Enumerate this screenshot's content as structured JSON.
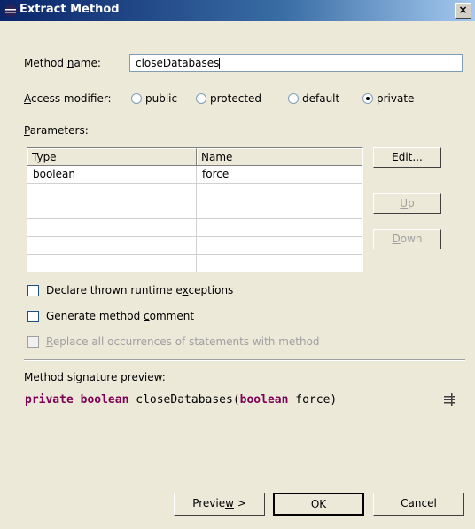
{
  "window": {
    "title": "Extract Method",
    "close_glyph": "×"
  },
  "method_name": {
    "label_pre": "Method ",
    "label_u": "n",
    "label_post": "ame:",
    "value": "closeDatabases"
  },
  "access": {
    "label_u": "A",
    "label_post": "ccess modifier:",
    "options": [
      "public",
      "protected",
      "default",
      "private"
    ],
    "selected": "private"
  },
  "parameters": {
    "label_u": "P",
    "label_post": "arameters:",
    "columns": [
      "Type",
      "Name"
    ],
    "rows": [
      {
        "type": "boolean",
        "name": "force"
      }
    ]
  },
  "buttons": {
    "edit_u": "E",
    "edit_post": "dit...",
    "up_u": "U",
    "up_post": "p",
    "down_u": "D",
    "down_post": "own"
  },
  "checkboxes": {
    "declare_pre": "Declare thrown runtime e",
    "declare_u": "x",
    "declare_post": "ceptions",
    "generate_pre": "Generate method ",
    "generate_u": "c",
    "generate_post": "omment",
    "replace_u": "R",
    "replace_post": "eplace all occurrences of statements with method"
  },
  "signature": {
    "label": "Method signature preview:",
    "kw1": "private",
    "kw2": "boolean",
    "name": "closeDatabases(",
    "kw3": "boolean",
    "param": "force)"
  },
  "footer": {
    "preview_pre": "Previe",
    "preview_u": "w",
    "preview_post": " >",
    "ok": "OK",
    "cancel": "Cancel"
  },
  "colors": {
    "keyword": "#7f0055",
    "titlebar": "#0a246a"
  }
}
